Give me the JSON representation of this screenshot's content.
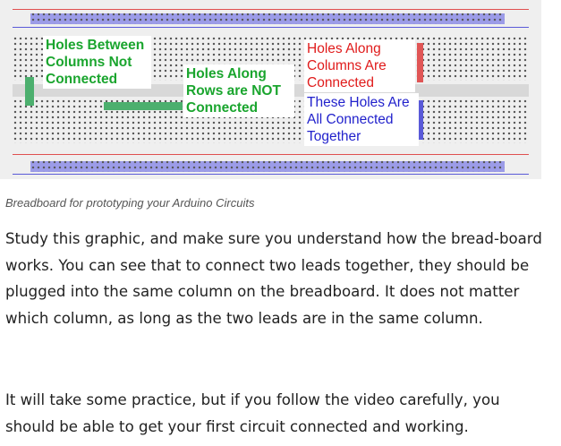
{
  "figure": {
    "labels": {
      "columns_not_connected": "Holes Between\nColumns Not\nConnected",
      "rows_not_connected": "Holes Along\nRows are NOT\nConnected",
      "columns_connected": "Holes Along\nColumns Are\nConnected",
      "all_connected": "These Holes Are\nAll Connected\nTogether"
    },
    "colors": {
      "green": "#1aa52e",
      "red": "#e01b1b",
      "blue": "#2222cc",
      "green_highlight": "#4caf6e",
      "red_highlight": "#e05555",
      "blue_highlight": "#5a5ad8"
    }
  },
  "caption": "Breadboard for prototyping your Arduino Circuits",
  "paragraphs": [
    "Study this graphic, and make sure you understand how the bread-board works. You can see that to connect two leads together, they should be plugged into the same column on the breadboard. It does not matter which column, as long as the two leads are in the same column.",
    "It will take some practice, but if you follow the video carefully, you should be able to get your first circuit connected and working."
  ]
}
